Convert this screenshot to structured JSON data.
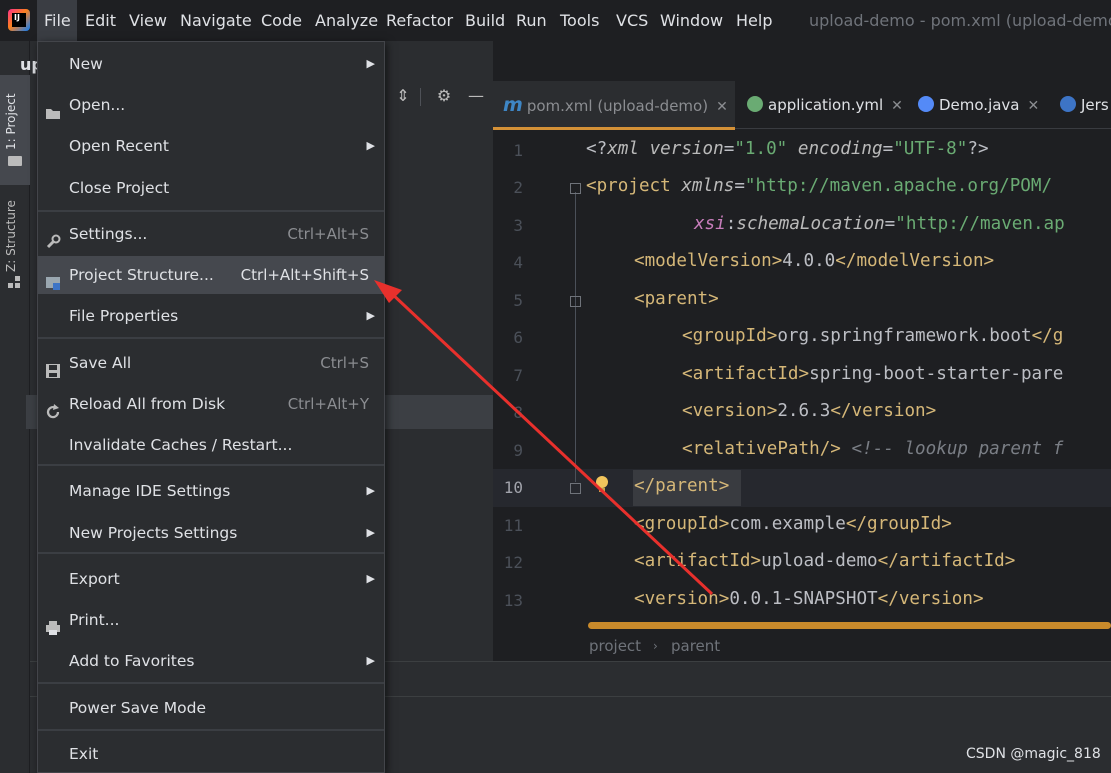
{
  "menubar": {
    "items": [
      "File",
      "Edit",
      "View",
      "Navigate",
      "Code",
      "Analyze",
      "Refactor",
      "Build",
      "Run",
      "Tools",
      "VCS",
      "Window",
      "Help"
    ],
    "window_title": "upload-demo - pom.xml (upload-demo) -"
  },
  "tool_strip": {
    "project_label": "1: Project",
    "structure_label": "Z: Structure"
  },
  "project_panel": {
    "title": "up"
  },
  "file_menu": {
    "items": [
      {
        "label": "New",
        "shortcut": "",
        "submenu": true,
        "icon": ""
      },
      {
        "label": "Open...",
        "shortcut": "",
        "submenu": false,
        "icon": "folder-open-icon"
      },
      {
        "label": "Open Recent",
        "shortcut": "",
        "submenu": true,
        "icon": ""
      },
      {
        "label": "Close Project",
        "shortcut": "",
        "submenu": false,
        "icon": ""
      },
      {
        "label": "Settings...",
        "shortcut": "Ctrl+Alt+S",
        "submenu": false,
        "icon": "wrench-icon"
      },
      {
        "label": "Project Structure...",
        "shortcut": "Ctrl+Alt+Shift+S",
        "submenu": false,
        "icon": "project-structure-icon"
      },
      {
        "label": "File Properties",
        "shortcut": "",
        "submenu": true,
        "icon": ""
      },
      {
        "label": "Save All",
        "shortcut": "Ctrl+S",
        "submenu": false,
        "icon": "save-icon"
      },
      {
        "label": "Reload All from Disk",
        "shortcut": "Ctrl+Alt+Y",
        "submenu": false,
        "icon": "reload-icon"
      },
      {
        "label": "Invalidate Caches / Restart...",
        "shortcut": "",
        "submenu": false,
        "icon": ""
      },
      {
        "label": "Manage IDE Settings",
        "shortcut": "",
        "submenu": true,
        "icon": ""
      },
      {
        "label": "New Projects Settings",
        "shortcut": "",
        "submenu": true,
        "icon": ""
      },
      {
        "label": "Export",
        "shortcut": "",
        "submenu": true,
        "icon": ""
      },
      {
        "label": "Print...",
        "shortcut": "",
        "submenu": false,
        "icon": "printer-icon"
      },
      {
        "label": "Add to Favorites",
        "shortcut": "",
        "submenu": true,
        "icon": ""
      },
      {
        "label": "Power Save Mode",
        "shortcut": "",
        "submenu": false,
        "icon": ""
      },
      {
        "label": "Exit",
        "shortcut": "",
        "submenu": false,
        "icon": ""
      }
    ],
    "selected": "Project Structure..."
  },
  "editor": {
    "tabs": [
      {
        "label": "pom.xml (upload-demo)",
        "icon": "maven-icon",
        "active": true
      },
      {
        "label": "application.yml",
        "icon": "spring-config-icon",
        "active": false
      },
      {
        "label": "Demo.java",
        "icon": "java-class-icon",
        "active": false
      },
      {
        "label": "Jers",
        "icon": "class-icon",
        "active": false
      }
    ],
    "line_numbers": [
      "1",
      "2",
      "3",
      "4",
      "5",
      "6",
      "7",
      "8",
      "9",
      "10",
      "11",
      "12",
      "13"
    ],
    "current_line": "10",
    "breadcrumbs": [
      "project",
      "parent"
    ]
  },
  "watermark": "CSDN @magic_818",
  "colors": {
    "background": "#1e1f22",
    "panel": "#2b2d30",
    "menu_selected": "#45484e",
    "tab_underline": "#d49137",
    "xml_tag": "#d5b778",
    "xml_string": "#6aab73",
    "arrow": "#e8302c"
  }
}
